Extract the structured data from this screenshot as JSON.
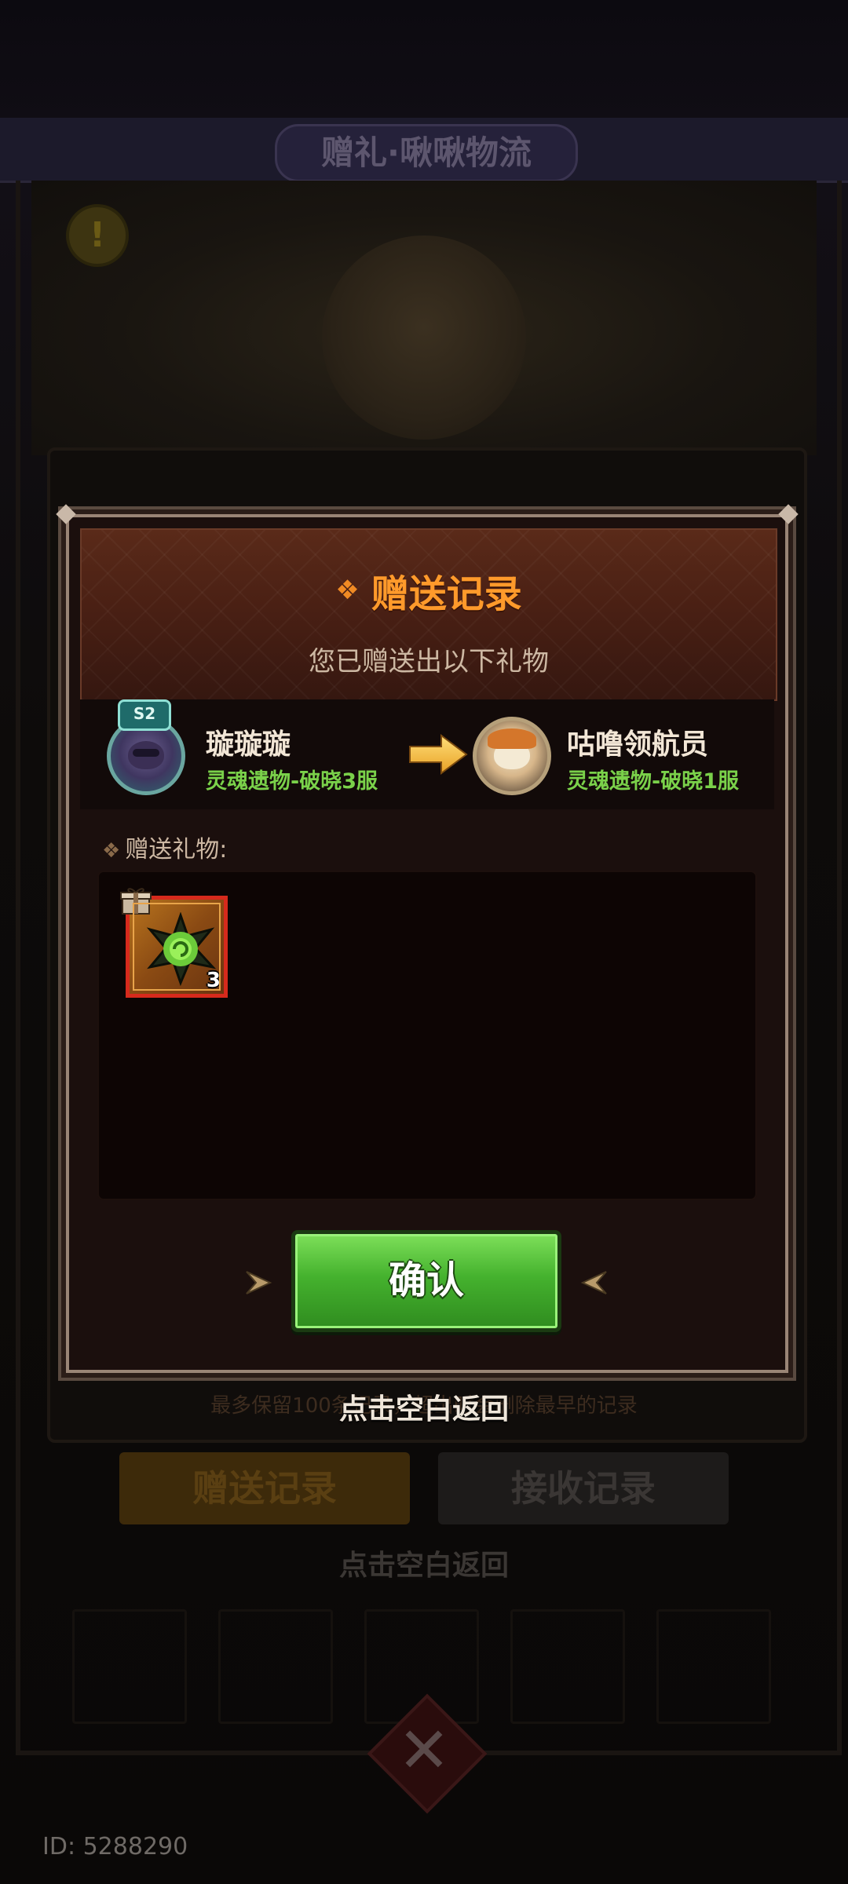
{
  "background": {
    "title": "赠礼·啾啾物流",
    "note": "最多保留100条记录，超出时会删除最早的记录",
    "tabs": [
      "赠送记录",
      "接收记录"
    ],
    "return_hint": "点击空白返回",
    "warning_symbol": "!",
    "id_text": "ID: 5288290"
  },
  "modal": {
    "title": "赠送记录",
    "subtitle": "您已赠送出以下礼物",
    "sender": {
      "badge": "S2",
      "name": "璇璇璇",
      "server": "灵魂遗物-破晓3服"
    },
    "receiver": {
      "name": "咕噜领航员",
      "server": "灵魂遗物-破晓1服"
    },
    "gifts_label": "赠送礼物:",
    "gifts": [
      {
        "icon": "green-spiked-gem-icon",
        "quantity": "3"
      }
    ],
    "confirm_label": "确认"
  },
  "tap_return": "点击空白返回",
  "colors": {
    "title_orange": "#ff9a2b",
    "server_green": "#7ad14a",
    "confirm_green": "#45b22e",
    "item_border_red": "#d62a1c"
  }
}
